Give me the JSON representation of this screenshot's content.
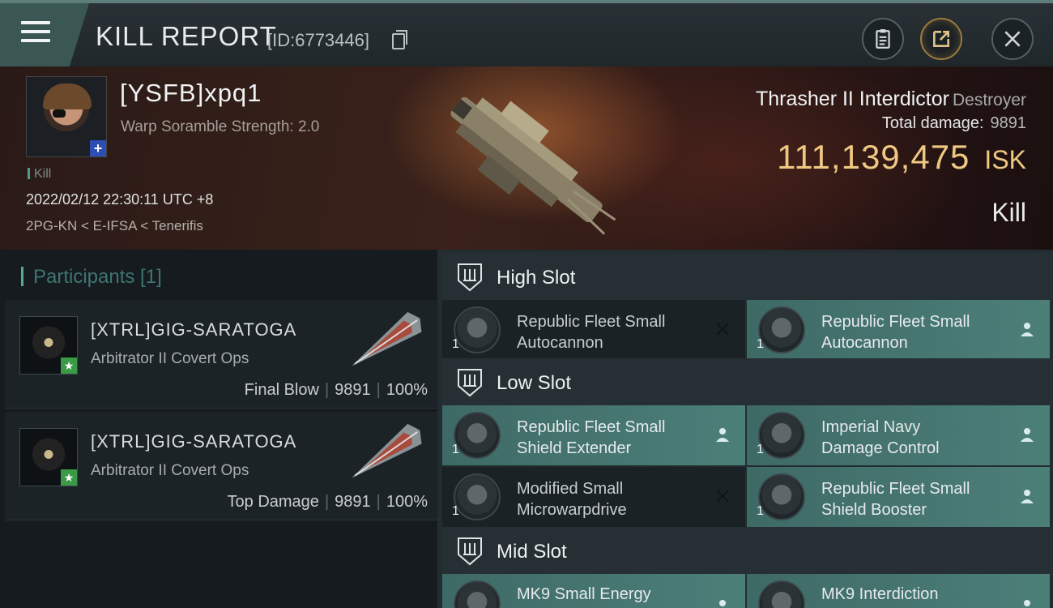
{
  "header": {
    "title": "KILL REPORT",
    "id_label": "[ID:6773446]"
  },
  "victim": {
    "name": "[YSFB]xpq1",
    "scramble": "Warp Soramble Strength: 2.0",
    "tag": "Kill",
    "datetime": "2022/02/12 22:30:11 UTC +8",
    "location": "2PG-KN < E-IFSA < Tenerifis",
    "ship_name": "Thrasher II Interdictor",
    "ship_class": "Destroyer",
    "total_damage_label": "Total damage:",
    "total_damage": "9891",
    "isk_value": "111,139,475",
    "isk_unit": "ISK",
    "result": "Kill"
  },
  "participants": {
    "header": "Participants [1]",
    "items": [
      {
        "name": "[XTRL]GIG-SARATOGA",
        "ship": "Arbitrator II Covert Ops",
        "role": "Final Blow",
        "damage": "9891",
        "percent": "100%"
      },
      {
        "name": "[XTRL]GIG-SARATOGA",
        "ship": "Arbitrator II Covert Ops",
        "role": "Top Damage",
        "damage": "9891",
        "percent": "100%"
      }
    ]
  },
  "slots": {
    "high": {
      "label": "High Slot",
      "modules": [
        {
          "qty": "1",
          "line1": "Republic Fleet Small",
          "line2": "Autocannon",
          "status": "destroyed"
        },
        {
          "qty": "1",
          "line1": "Republic Fleet Small",
          "line2": "Autocannon",
          "status": "dropped"
        }
      ]
    },
    "low": {
      "label": "Low Slot",
      "modules": [
        {
          "qty": "1",
          "line1": "Republic Fleet Small",
          "line2": "Shield Extender",
          "status": "dropped"
        },
        {
          "qty": "1",
          "line1": "Imperial Navy",
          "line2": "Damage Control",
          "status": "dropped"
        },
        {
          "qty": "1",
          "line1": "Modified Small",
          "line2": "Microwarpdrive",
          "status": "destroyed"
        },
        {
          "qty": "1",
          "line1": "Republic Fleet Small",
          "line2": "Shield Booster",
          "status": "dropped"
        }
      ]
    },
    "mid": {
      "label": "Mid Slot",
      "modules": [
        {
          "qty": "",
          "line1": "MK9 Small Energy",
          "line2": "",
          "status": "dropped"
        },
        {
          "qty": "",
          "line1": "MK9 Interdiction",
          "line2": "",
          "status": "dropped"
        }
      ]
    }
  },
  "colors": {
    "accent": "#4d7f79",
    "isk": "#efc882",
    "header_bar": "#3b5753"
  },
  "icons": [
    "menu-icon",
    "copy-icon",
    "clipboard-icon",
    "share-icon",
    "close-icon",
    "slot-shield-icon",
    "pilot-icon",
    "destroyed-x-icon"
  ]
}
